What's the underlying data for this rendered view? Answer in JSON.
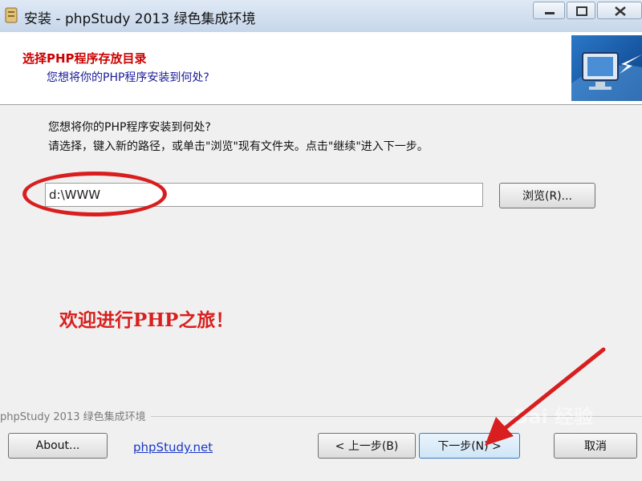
{
  "window": {
    "title": "安装 - phpStudy 2013 绿色集成环境",
    "controls": {
      "min": "minimize",
      "max": "maximize",
      "close": "close"
    }
  },
  "header": {
    "title": "选择PHP程序存放目录",
    "subtitle": "您想将你的PHP程序安装到何处?"
  },
  "instructions": {
    "line1": "您想将你的PHP程序安装到何处?",
    "line2": "请选择，键入新的路径，或单击\"浏览\"现有文件夹。点击\"继续\"进入下一步。"
  },
  "path_field": {
    "value": "d:\\WWW"
  },
  "browse_label": "浏览(R)...",
  "welcome_text": "欢迎进行PHP之旅！",
  "footer": {
    "group_label": "phpStudy 2013 绿色集成环境",
    "about_label": "About...",
    "link_text": "phpStudy.net",
    "back_label": "< 上一步(B)",
    "next_label": "下一步(N) >",
    "cancel_label": "取消"
  },
  "annotations": {
    "highlight_color": "#d81e1e"
  },
  "watermark": "Bai 经验",
  "icons": [
    "app-icon",
    "monitor-icon",
    "minimize-icon",
    "maximize-icon",
    "close-icon",
    "arrow-annotation"
  ]
}
